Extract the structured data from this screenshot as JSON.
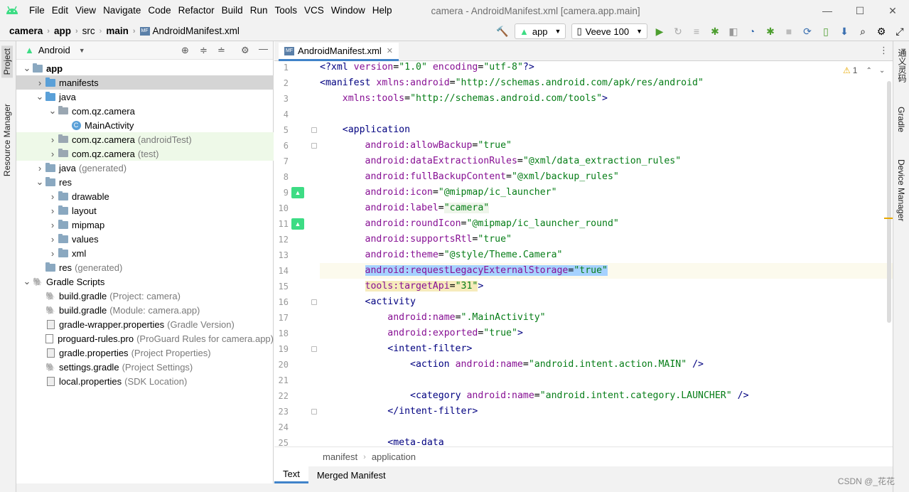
{
  "window": {
    "title": "camera - AndroidManifest.xml [camera.app.main]",
    "menu": [
      "File",
      "Edit",
      "View",
      "Navigate",
      "Code",
      "Refactor",
      "Build",
      "Run",
      "Tools",
      "VCS",
      "Window",
      "Help"
    ],
    "controls": {
      "minimize": "—",
      "maximize": "☐",
      "close": "✕"
    }
  },
  "breadcrumb": [
    "camera",
    "app",
    "src",
    "main",
    "AndroidManifest.xml"
  ],
  "toolbar": {
    "run_config": "app",
    "device": "Veeve 100"
  },
  "left_strip": {
    "project": "Project",
    "resource_manager": "Resource Manager"
  },
  "right_strip": {
    "translate": "通义灵码",
    "gradle": "Gradle",
    "device_manager": "Device Manager"
  },
  "project_panel": {
    "view_mode": "Android",
    "tree": [
      {
        "label": "app",
        "note": "",
        "indent": 0,
        "arrow": "▾",
        "icon": "module",
        "bold": true
      },
      {
        "label": "manifests",
        "note": "",
        "indent": 1,
        "arrow": "▸",
        "icon": "folder-blue",
        "selected": true
      },
      {
        "label": "java",
        "note": "",
        "indent": 1,
        "arrow": "▾",
        "icon": "folder-blue"
      },
      {
        "label": "com.qz.camera",
        "note": "",
        "indent": 2,
        "arrow": "▾",
        "icon": "package"
      },
      {
        "label": "MainActivity",
        "note": "",
        "indent": 3,
        "arrow": "",
        "icon": "class"
      },
      {
        "label": "com.qz.camera",
        "note": "(androidTest)",
        "indent": 2,
        "arrow": "▸",
        "icon": "package",
        "green": true
      },
      {
        "label": "com.qz.camera",
        "note": "(test)",
        "indent": 2,
        "arrow": "▸",
        "icon": "package",
        "green": true
      },
      {
        "label": "java",
        "note": "(generated)",
        "indent": 1,
        "arrow": "▸",
        "icon": "folder-gen"
      },
      {
        "label": "res",
        "note": "",
        "indent": 1,
        "arrow": "▾",
        "icon": "folder-res"
      },
      {
        "label": "drawable",
        "note": "",
        "indent": 2,
        "arrow": "▸",
        "icon": "folder"
      },
      {
        "label": "layout",
        "note": "",
        "indent": 2,
        "arrow": "▸",
        "icon": "folder"
      },
      {
        "label": "mipmap",
        "note": "",
        "indent": 2,
        "arrow": "▸",
        "icon": "folder"
      },
      {
        "label": "values",
        "note": "",
        "indent": 2,
        "arrow": "▸",
        "icon": "folder"
      },
      {
        "label": "xml",
        "note": "",
        "indent": 2,
        "arrow": "▸",
        "icon": "folder"
      },
      {
        "label": "res",
        "note": "(generated)",
        "indent": 1,
        "arrow": "",
        "icon": "folder-gen"
      },
      {
        "label": "Gradle Scripts",
        "note": "",
        "indent": 0,
        "arrow": "▾",
        "icon": "gradle"
      },
      {
        "label": "build.gradle",
        "note": "(Project: camera)",
        "indent": 1,
        "arrow": "",
        "icon": "gradle"
      },
      {
        "label": "build.gradle",
        "note": "(Module: camera.app)",
        "indent": 1,
        "arrow": "",
        "icon": "gradle"
      },
      {
        "label": "gradle-wrapper.properties",
        "note": "(Gradle Version)",
        "indent": 1,
        "arrow": "",
        "icon": "props"
      },
      {
        "label": "proguard-rules.pro",
        "note": "(ProGuard Rules for camera.app)",
        "indent": 1,
        "arrow": "",
        "icon": "file"
      },
      {
        "label": "gradle.properties",
        "note": "(Project Properties)",
        "indent": 1,
        "arrow": "",
        "icon": "props"
      },
      {
        "label": "settings.gradle",
        "note": "(Project Settings)",
        "indent": 1,
        "arrow": "",
        "icon": "gradle"
      },
      {
        "label": "local.properties",
        "note": "(SDK Location)",
        "indent": 1,
        "arrow": "",
        "icon": "props"
      }
    ]
  },
  "editor": {
    "tab": "AndroidManifest.xml",
    "warnings": "1",
    "lines": [
      {
        "n": "1",
        "html": "<span class='tag'>&lt;?xml</span> <span class='attr'>version</span>=<span class='val'>\"1.0\"</span> <span class='attr'>encoding</span>=<span class='val'>\"utf-8\"</span><span class='tag'>?&gt;</span>"
      },
      {
        "n": "2",
        "html": "<span class='tag'>&lt;manifest</span> <span class='attr'>xmlns:android</span>=<span class='val'>\"http://schemas.android.com/apk/res/android\"</span>"
      },
      {
        "n": "3",
        "html": "    <span class='attr'>xmlns:tools</span>=<span class='val'>\"http://schemas.android.com/tools\"</span><span class='tag'>&gt;</span>"
      },
      {
        "n": "4",
        "html": ""
      },
      {
        "n": "5",
        "html": "    <span class='tag'>&lt;application</span>"
      },
      {
        "n": "6",
        "html": "        <span class='ns'>android:</span><span class='attr'>allowBackup</span>=<span class='val'>\"true\"</span>"
      },
      {
        "n": "7",
        "html": "        <span class='ns'>android:</span><span class='attr'>dataExtractionRules</span>=<span class='val'>\"@xml/data_extraction_rules\"</span>"
      },
      {
        "n": "8",
        "html": "        <span class='ns'>android:</span><span class='attr'>fullBackupContent</span>=<span class='val'>\"@xml/backup_rules\"</span>"
      },
      {
        "n": "9",
        "html": "        <span class='ns'>android:</span><span class='attr'>icon</span>=<span class='val'>\"@mipmap/ic_launcher\"</span>"
      },
      {
        "n": "10",
        "html": "        <span class='ns'>android:</span><span class='attr'>label</span>=<span class='val' style='background:#eef5ea'>\"camera\"</span>"
      },
      {
        "n": "11",
        "html": "        <span class='ns'>android:</span><span class='attr'>roundIcon</span>=<span class='val'>\"@mipmap/ic_launcher_round\"</span>"
      },
      {
        "n": "12",
        "html": "        <span class='ns'>android:</span><span class='attr'>supportsRtl</span>=<span class='val'>\"true\"</span>"
      },
      {
        "n": "13",
        "html": "        <span class='ns'>android:</span><span class='attr'>theme</span>=<span class='val'>\"@style/Theme.Camera\"</span>"
      },
      {
        "n": "14",
        "html": "        <span class='hl'><span class='ns'>android:</span><span class='attr'>requestLegacyExternalStorage</span>=<span class='val'>\"true\"</span></span>"
      },
      {
        "n": "15",
        "html": "        <span class='warnbg'><span class='ns'>tools:</span><span class='attr'>targetApi</span>=<span class='val'>\"31\"</span></span><span class='tag'>&gt;</span>"
      },
      {
        "n": "16",
        "html": "        <span class='tag'>&lt;activity</span>"
      },
      {
        "n": "17",
        "html": "            <span class='ns'>android:</span><span class='attr'>name</span>=<span class='val'>\".MainActivity\"</span>"
      },
      {
        "n": "18",
        "html": "            <span class='ns'>android:</span><span class='attr'>exported</span>=<span class='val'>\"true\"</span><span class='tag'>&gt;</span>"
      },
      {
        "n": "19",
        "html": "            <span class='tag'>&lt;intent-filter&gt;</span>"
      },
      {
        "n": "20",
        "html": "                <span class='tag'>&lt;action</span> <span class='ns'>android:</span><span class='attr'>name</span>=<span class='val'>\"android.intent.action.MAIN\"</span> <span class='tag'>/&gt;</span>"
      },
      {
        "n": "21",
        "html": ""
      },
      {
        "n": "22",
        "html": "                <span class='tag'>&lt;category</span> <span class='ns'>android:</span><span class='attr'>name</span>=<span class='val'>\"android.intent.category.LAUNCHER\"</span> <span class='tag'>/&gt;</span>"
      },
      {
        "n": "23",
        "html": "            <span class='tag'>&lt;/intent-filter&gt;</span>"
      },
      {
        "n": "24",
        "html": ""
      },
      {
        "n": "25",
        "html": "            <span class='tag'>&lt;meta-data</span>"
      }
    ],
    "current_line": "14",
    "breadcrumbs": [
      "manifest",
      "application"
    ],
    "bottom_tabs": [
      "Text",
      "Merged Manifest"
    ]
  },
  "watermark": "CSDN @_花花",
  "colors": {
    "accent": "#4083c9",
    "tag": "#000080",
    "attr": "#871094",
    "value": "#067d17"
  }
}
